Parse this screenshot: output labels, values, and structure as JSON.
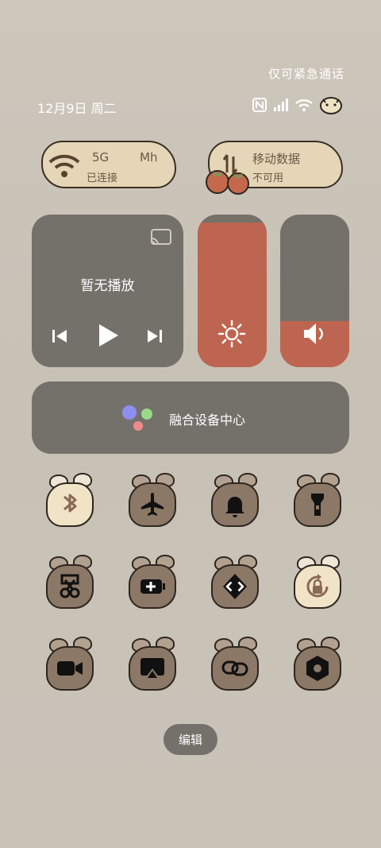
{
  "status": {
    "emergency": "仅可紧急通话",
    "date": "12月9日 周二"
  },
  "network": {
    "wifi": {
      "title": "5G",
      "title_extra": "Mh",
      "subtitle": "已连接"
    },
    "mobile": {
      "title": "移动数据",
      "subtitle": "不可用"
    }
  },
  "media": {
    "title": "暂无播放"
  },
  "sliders": {
    "brightness_level": 0.95,
    "volume_level": 0.3
  },
  "fusion": {
    "label": "融合设备中心"
  },
  "toggles": [
    {
      "icon": "bluetooth-icon",
      "active": true
    },
    {
      "icon": "airplane-icon",
      "active": false
    },
    {
      "icon": "bell-icon",
      "active": false
    },
    {
      "icon": "flashlight-icon",
      "active": false
    },
    {
      "icon": "screenshot-icon",
      "active": false
    },
    {
      "icon": "battery-saver-icon",
      "active": false
    },
    {
      "icon": "share-icon",
      "active": false
    },
    {
      "icon": "rotation-lock-icon",
      "active": true
    },
    {
      "icon": "screen-record-icon",
      "active": false
    },
    {
      "icon": "cast-icon",
      "active": false
    },
    {
      "icon": "link-icon",
      "active": false
    },
    {
      "icon": "settings-icon",
      "active": false
    }
  ],
  "edit": {
    "label": "编辑"
  },
  "colors": {
    "card": "#74716b",
    "accent": "#bd6550",
    "tile_dark": "#8c7866",
    "tile_light": "#f1e3c6"
  }
}
